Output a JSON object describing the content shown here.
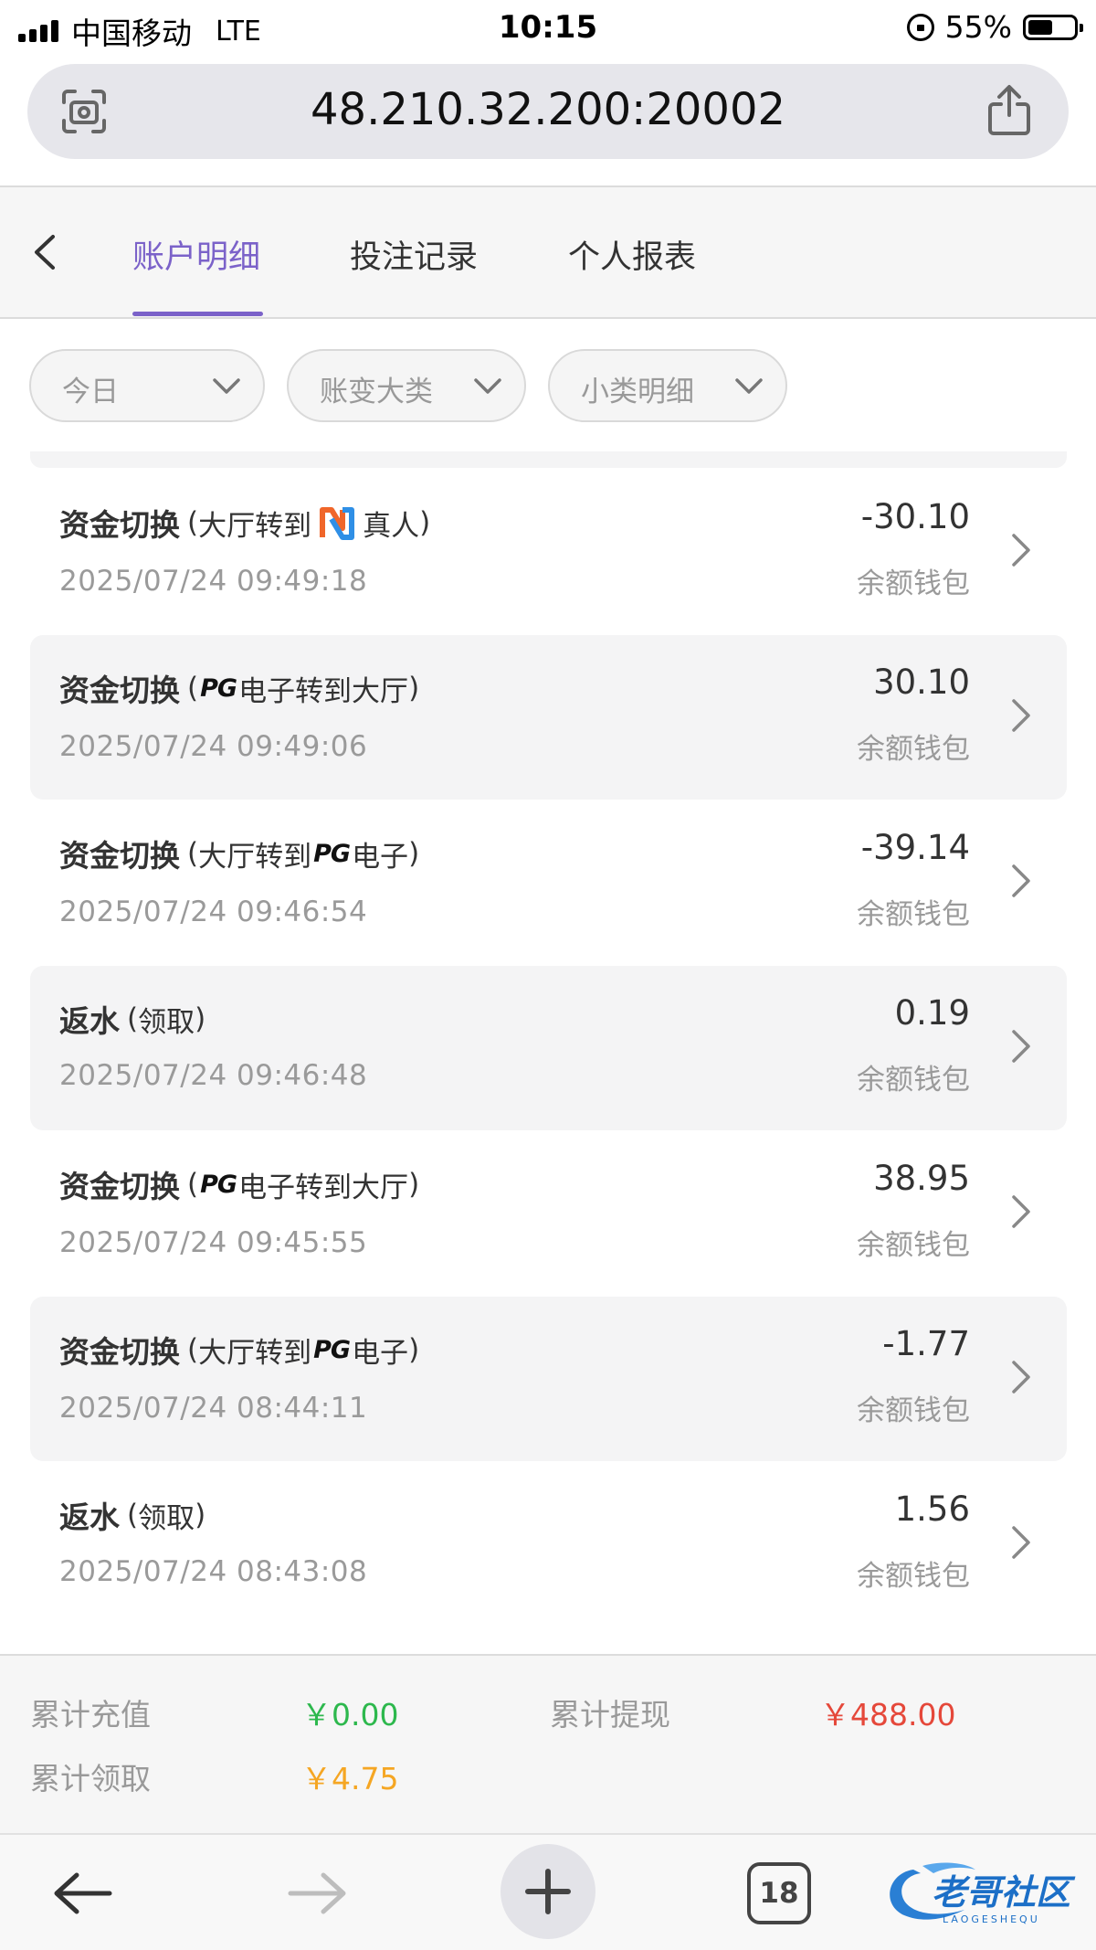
{
  "status_bar": {
    "carrier": "中国移动",
    "network": "LTE",
    "time": "10:15",
    "battery": "55%",
    "battery_level": 0.55
  },
  "browser": {
    "url": "48.210.32.200:20002",
    "tabs_count": "18"
  },
  "tabs": [
    {
      "label": "账户明细",
      "active": true
    },
    {
      "label": "投注记录",
      "active": false
    },
    {
      "label": "个人报表",
      "active": false
    }
  ],
  "filters": [
    {
      "label": "今日"
    },
    {
      "label": "账变大类"
    },
    {
      "label": "小类明细"
    }
  ],
  "records": [
    {
      "title": "资金切换",
      "paren_open": "(",
      "paren_close": ")",
      "part1": "大厅转到",
      "logo": "n-logo",
      "part2": "真人",
      "time": "2025/07/24 09:49:18",
      "amount": "-30.10",
      "wallet": "余额钱包"
    },
    {
      "title": "资金切换",
      "paren_open": "(",
      "paren_close": ")",
      "part1": "",
      "logo_text": "PG",
      "part2": "电子转到大厅",
      "time": "2025/07/24 09:49:06",
      "amount": "30.10",
      "wallet": "余额钱包"
    },
    {
      "title": "资金切换",
      "paren_open": "(",
      "paren_close": ")",
      "part1": "大厅转到",
      "logo_text": "PG",
      "part2": "电子",
      "time": "2025/07/24 09:46:54",
      "amount": "-39.14",
      "wallet": "余额钱包"
    },
    {
      "title": "返水",
      "paren_open": "(",
      "paren_close": ")",
      "part1": "领取",
      "part2": "",
      "time": "2025/07/24 09:46:48",
      "amount": "0.19",
      "wallet": "余额钱包"
    },
    {
      "title": "资金切换",
      "paren_open": "(",
      "paren_close": ")",
      "part1": "",
      "logo_text": "PG",
      "part2": "电子转到大厅",
      "time": "2025/07/24 09:45:55",
      "amount": "38.95",
      "wallet": "余额钱包"
    },
    {
      "title": "资金切换",
      "paren_open": "(",
      "paren_close": ")",
      "part1": "大厅转到",
      "logo_text": "PG",
      "part2": "电子",
      "time": "2025/07/24 08:44:11",
      "amount": "-1.77",
      "wallet": "余额钱包"
    },
    {
      "title": "返水",
      "paren_open": "(",
      "paren_close": ")",
      "part1": "领取",
      "part2": "",
      "time": "2025/07/24 08:43:08",
      "amount": "1.56",
      "wallet": "余额钱包"
    }
  ],
  "summary": {
    "recharge_label": "累计充值",
    "recharge_value": "￥0.00",
    "withdraw_label": "累计提现",
    "withdraw_value": "￥488.00",
    "claimed_label": "累计领取",
    "claimed_value": "￥4.75"
  },
  "colors": {
    "accent": "#7b62c9",
    "recharge": "#2db84d",
    "withdraw": "#e5483a",
    "claimed": "#f5a623"
  },
  "icons": {
    "back": "chevron-left-icon",
    "scan": "page-scan-icon",
    "share": "share-icon",
    "row_arrow": "chevron-right-icon",
    "filter_arrow": "chevron-down-icon",
    "toolbar": [
      "back-arrow-icon",
      "forward-arrow-icon",
      "plus-icon",
      "tabs-icon"
    ]
  }
}
